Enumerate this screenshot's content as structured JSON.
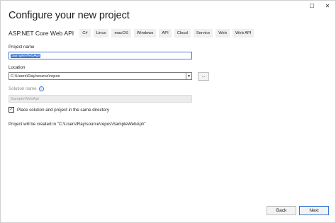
{
  "window": {
    "caption_buttons": [
      {
        "name": "maximize",
        "glyph": "☐"
      },
      {
        "name": "close",
        "glyph": "✕"
      }
    ]
  },
  "title": "Configure your new project",
  "template": {
    "name": "ASP.NET Core Web API",
    "tags": [
      "C#",
      "Linux",
      "macOS",
      "Windows",
      "API",
      "Cloud",
      "Service",
      "Web",
      "Web API"
    ]
  },
  "project_name": {
    "label": "Project name",
    "value": "SampleWebApi"
  },
  "location": {
    "label": "Location",
    "value": "C:\\Users\\Ray\\source\\repos",
    "browse_label": "..."
  },
  "solution_name": {
    "label": "Solution name",
    "value": "SampleWebApi"
  },
  "same_directory": {
    "label": "Place solution and project in the same directory",
    "checked": true
  },
  "created_message": "Project will be created in \"C:\\Users\\Ray\\source\\repos\\SampleWebApi\\\"",
  "footer": {
    "back_label": "Back",
    "next_label": "Next"
  },
  "colors": {
    "accent": "#3a76d6"
  }
}
